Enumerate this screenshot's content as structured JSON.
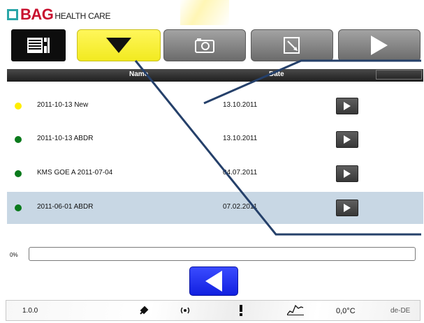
{
  "logo": {
    "brand": "BAG",
    "tagline": "HEALTH CARE"
  },
  "toolbar": {
    "list_icon": "list-icon",
    "down_icon": "triangle-down-icon",
    "camera_icon": "camera-icon",
    "note_icon": "note-icon",
    "play_icon": "play-icon",
    "accent_yellow": "#f5ee2a"
  },
  "table": {
    "columns": [
      "Name",
      "Date"
    ],
    "rows": [
      {
        "status_color": "#ffee00",
        "name": "2011-10-13 New",
        "date": "13.10.2011",
        "selected": false
      },
      {
        "status_color": "#0a7a1c",
        "name": "2011-10-13 ABDR",
        "date": "13.10.2011",
        "selected": false
      },
      {
        "status_color": "#0a7a1c",
        "name": "KMS GOE A 2011-07-04",
        "date": "04.07.2011",
        "selected": false
      },
      {
        "status_color": "#0a7a1c",
        "name": "2011-06-01 ABDR",
        "date": "07.02.2011",
        "selected": true
      }
    ]
  },
  "progress": {
    "label": "0%",
    "value": 0
  },
  "back_button": {
    "icon": "triangle-left-icon",
    "color": "#1a2cf0"
  },
  "status_bar": {
    "version": "1.0.0",
    "icons": [
      "plug-icon",
      "radio-signal-icon",
      "alert-icon",
      "chart-icon"
    ],
    "temperature": "0,0°C",
    "locale": "de-DE"
  }
}
